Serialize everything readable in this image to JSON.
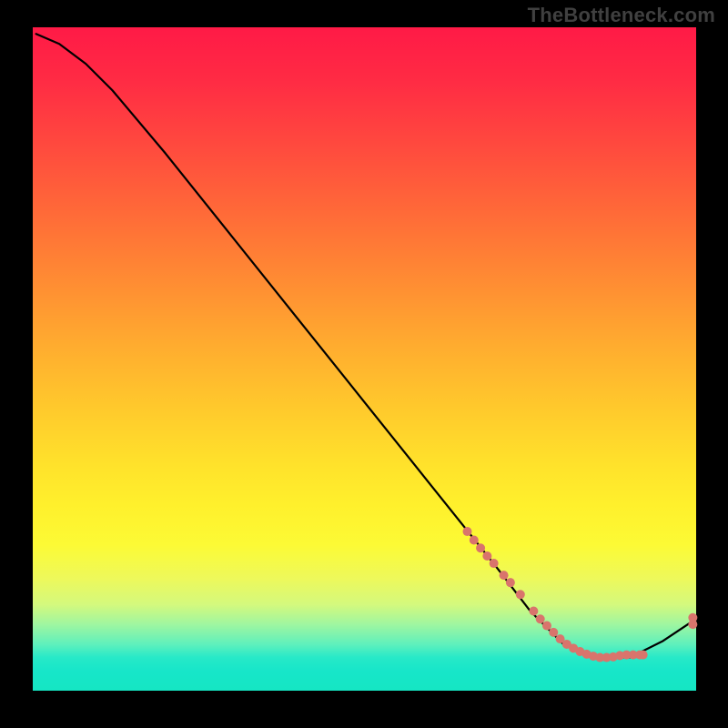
{
  "watermark": "TheBottleneck.com",
  "chart_data": {
    "type": "line",
    "title": "",
    "xlabel": "",
    "ylabel": "",
    "xlim": [
      0,
      100
    ],
    "ylim": [
      0,
      100
    ],
    "grid": false,
    "legend": false,
    "series": [
      {
        "name": "curve",
        "color": "#000000",
        "x": [
          0.5,
          4.0,
          8.0,
          12.0,
          20.0,
          30.0,
          40.0,
          50.0,
          60.0,
          66.0,
          70.0,
          75.0,
          80.0,
          85.0,
          90.0,
          95.0,
          99.5
        ],
        "values": [
          99.0,
          97.5,
          94.5,
          90.5,
          81.0,
          68.5,
          56.0,
          43.5,
          31.0,
          23.5,
          18.5,
          12.0,
          7.0,
          5.0,
          5.0,
          7.5,
          10.5
        ]
      }
    ],
    "markers": {
      "name": "dots",
      "color": "#d9746c",
      "radius_px": 5,
      "label_text": "",
      "label_color": "#c1534b",
      "label_at_x": 82,
      "x": [
        65.5,
        66.5,
        67.5,
        68.5,
        69.5,
        71.0,
        72.0,
        73.5,
        75.5,
        76.5,
        77.5,
        78.5,
        79.5,
        80.5,
        81.5,
        82.5,
        83.5,
        84.5,
        85.5,
        86.5,
        87.5,
        88.5,
        89.5,
        90.5,
        91.5,
        92.0,
        99.5,
        99.5
      ],
      "values": [
        24.0,
        22.7,
        21.5,
        20.3,
        19.2,
        17.4,
        16.3,
        14.5,
        12.0,
        10.8,
        9.8,
        8.8,
        7.8,
        7.0,
        6.4,
        5.9,
        5.5,
        5.2,
        5.0,
        5.0,
        5.1,
        5.3,
        5.4,
        5.4,
        5.4,
        5.4,
        10.0,
        11.0
      ]
    }
  }
}
